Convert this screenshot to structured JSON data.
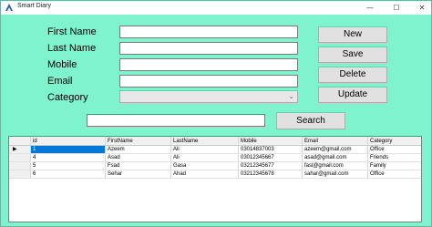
{
  "window": {
    "title": "Smart Diary"
  },
  "titlebar_buttons": {
    "minimize": "—",
    "maximize": "☐",
    "close": "✕"
  },
  "form": {
    "first_name_label": "First Name",
    "last_name_label": "Last Name",
    "mobile_label": "Mobile",
    "email_label": "Email",
    "category_label": "Category",
    "first_name_value": "",
    "last_name_value": "",
    "mobile_value": "",
    "email_value": "",
    "category_value": ""
  },
  "buttons": {
    "new": "New",
    "save": "Save",
    "delete": "Delete",
    "update": "Update",
    "search": "Search"
  },
  "search": {
    "value": ""
  },
  "grid": {
    "columns": [
      "id",
      "FirstName",
      "LastName",
      "Mobile",
      "Email",
      "Category"
    ],
    "rows": [
      {
        "id": "1",
        "first": "Azeem",
        "last": "Ali",
        "mobile": "03014837003",
        "email": "azeem@gmail.com",
        "category": "Office"
      },
      {
        "id": "4",
        "first": "Asad",
        "last": "Ali",
        "mobile": "03012345667",
        "email": "asad@gmail.com",
        "category": "Friends"
      },
      {
        "id": "5",
        "first": "Fsad",
        "last": "Gasa",
        "mobile": "03212345677",
        "email": "fasl@gmail.com",
        "category": "Family"
      },
      {
        "id": "6",
        "first": "Sehar",
        "last": "Ahad",
        "mobile": "03212345678",
        "email": "sahar@gmail.com",
        "category": "Office"
      }
    ],
    "current_row_marker": "▶"
  }
}
